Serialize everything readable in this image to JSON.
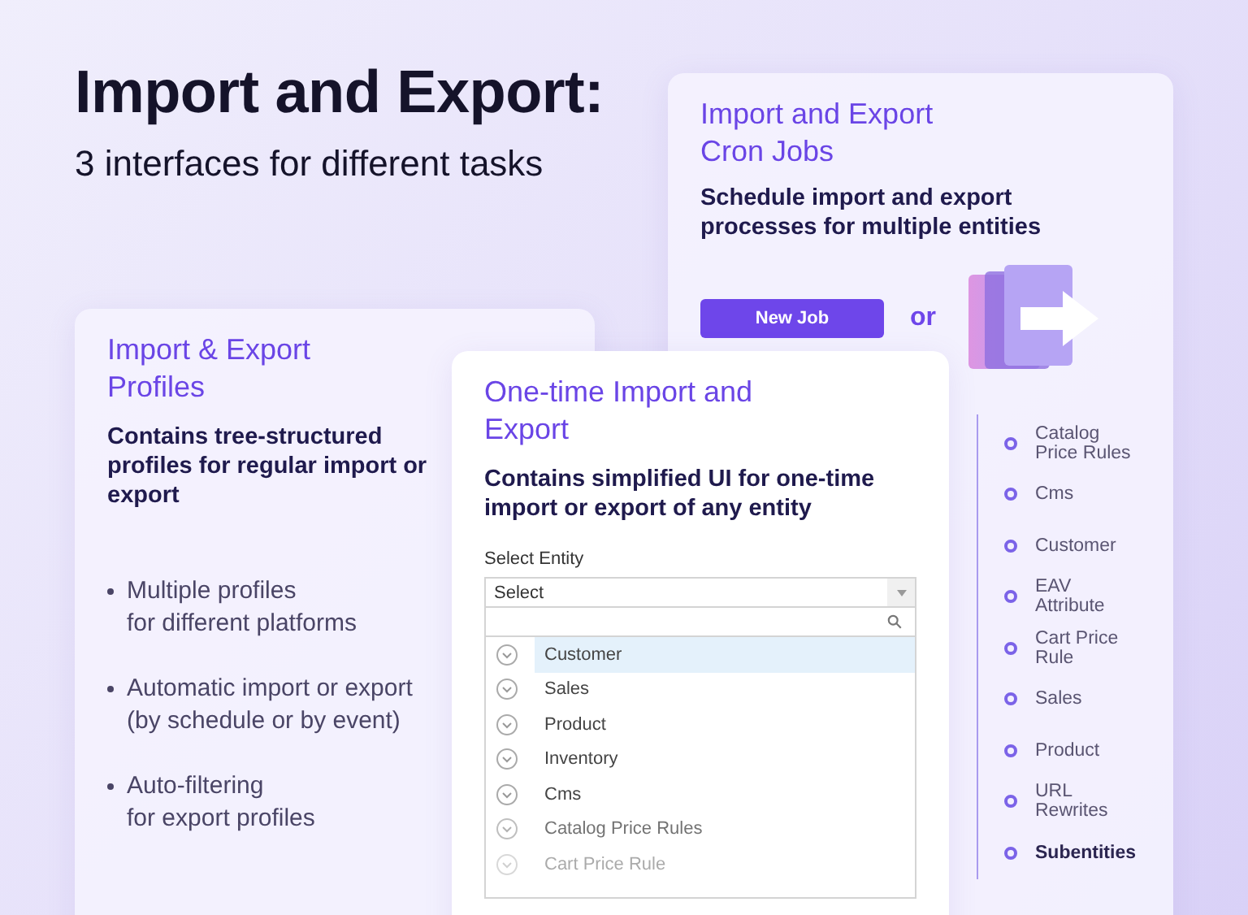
{
  "heading": {
    "title": "Import and Export:",
    "subtitle": "3 interfaces for different tasks"
  },
  "cron_card": {
    "title": "Import and Export Cron Jobs",
    "description": "Schedule import and export processes for multiple entities",
    "button": "New Job",
    "or": "or",
    "tree": [
      {
        "label": "Catalog Price Rules",
        "kind": "entity"
      },
      {
        "label": "Cms",
        "kind": "entity"
      },
      {
        "label": "Customer",
        "kind": "entity"
      },
      {
        "label": "EAV Attribute",
        "kind": "entity"
      },
      {
        "label": "Cart Price Rule",
        "kind": "entity"
      },
      {
        "label": "Sales",
        "kind": "entity"
      },
      {
        "label": "Product",
        "kind": "entity"
      },
      {
        "label": "URL Rewrites",
        "kind": "entity"
      },
      {
        "label": "Subentities",
        "kind": "group"
      }
    ]
  },
  "profiles_card": {
    "title": "Import & Export Profiles",
    "description": "Contains tree-structured profiles for regular import or export",
    "bullets": [
      {
        "line1": "Multiple profiles",
        "line2": "for different platforms"
      },
      {
        "line1": "Automatic import or export",
        "line2": "(by schedule or by event)"
      },
      {
        "line1": "Auto-filtering",
        "line2": "for export profiles"
      }
    ]
  },
  "onetime_card": {
    "title": "One-time Import and Export",
    "description": "Contains simplified UI for one-time import or export of any entity",
    "field_label": "Select Entity",
    "select": {
      "placeholder": "Select"
    },
    "options": [
      {
        "label": "Customer",
        "selected": true
      },
      {
        "label": "Sales",
        "selected": false
      },
      {
        "label": "Product",
        "selected": false
      },
      {
        "label": "Inventory",
        "selected": false
      },
      {
        "label": "Cms",
        "selected": false
      },
      {
        "label": "Catalog Price Rules",
        "selected": false
      },
      {
        "label": "Cart Price Rule",
        "selected": false
      }
    ]
  }
}
